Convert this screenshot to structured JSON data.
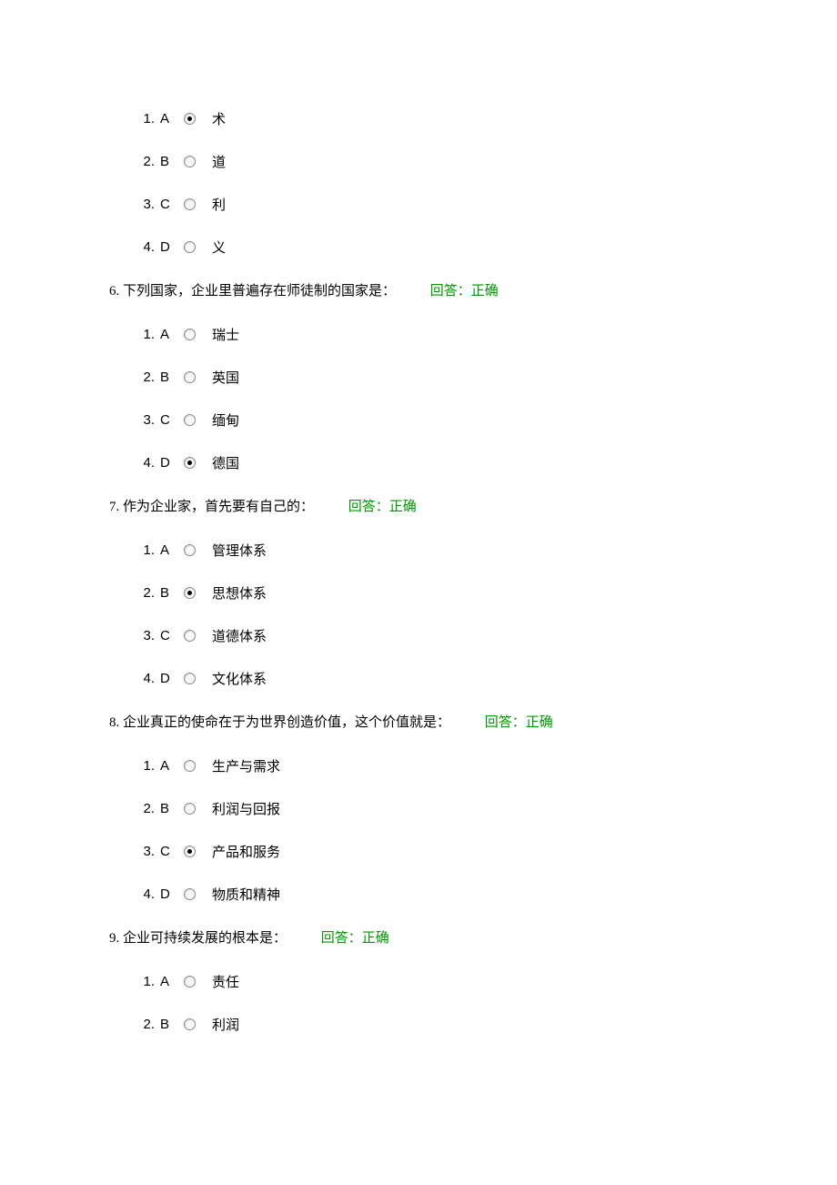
{
  "block1_options": [
    {
      "num": "1.",
      "letter": "A",
      "text": "术",
      "selected": true
    },
    {
      "num": "2.",
      "letter": "B",
      "text": "道",
      "selected": false
    },
    {
      "num": "3.",
      "letter": "C",
      "text": "利",
      "selected": false
    },
    {
      "num": "4.",
      "letter": "D",
      "text": "义",
      "selected": false
    }
  ],
  "questions": [
    {
      "num": "6.",
      "text": "下列国家，企业里普遍存在师徒制的国家是：",
      "feedback": "回答：正确",
      "options": [
        {
          "num": "1.",
          "letter": "A",
          "text": "瑞士",
          "selected": false
        },
        {
          "num": "2.",
          "letter": "B",
          "text": "英国",
          "selected": false
        },
        {
          "num": "3.",
          "letter": "C",
          "text": "缅甸",
          "selected": false
        },
        {
          "num": "4.",
          "letter": "D",
          "text": "德国",
          "selected": true
        }
      ]
    },
    {
      "num": "7.",
      "text": "作为企业家，首先要有自己的：",
      "feedback": "回答：正确",
      "options": [
        {
          "num": "1.",
          "letter": "A",
          "text": "管理体系",
          "selected": false
        },
        {
          "num": "2.",
          "letter": "B",
          "text": "思想体系",
          "selected": true
        },
        {
          "num": "3.",
          "letter": "C",
          "text": "道德体系",
          "selected": false
        },
        {
          "num": "4.",
          "letter": "D",
          "text": "文化体系",
          "selected": false
        }
      ]
    },
    {
      "num": "8.",
      "text": "企业真正的使命在于为世界创造价值，这个价值就是：",
      "feedback": "回答：正确",
      "options": [
        {
          "num": "1.",
          "letter": "A",
          "text": "生产与需求",
          "selected": false
        },
        {
          "num": "2.",
          "letter": "B",
          "text": "利润与回报",
          "selected": false
        },
        {
          "num": "3.",
          "letter": "C",
          "text": "产品和服务",
          "selected": true
        },
        {
          "num": "4.",
          "letter": "D",
          "text": "物质和精神",
          "selected": false
        }
      ]
    },
    {
      "num": "9.",
      "text": "企业可持续发展的根本是：",
      "feedback": "回答：正确",
      "options": [
        {
          "num": "1.",
          "letter": "A",
          "text": "责任",
          "selected": false
        },
        {
          "num": "2.",
          "letter": "B",
          "text": "利润",
          "selected": false
        }
      ]
    }
  ]
}
